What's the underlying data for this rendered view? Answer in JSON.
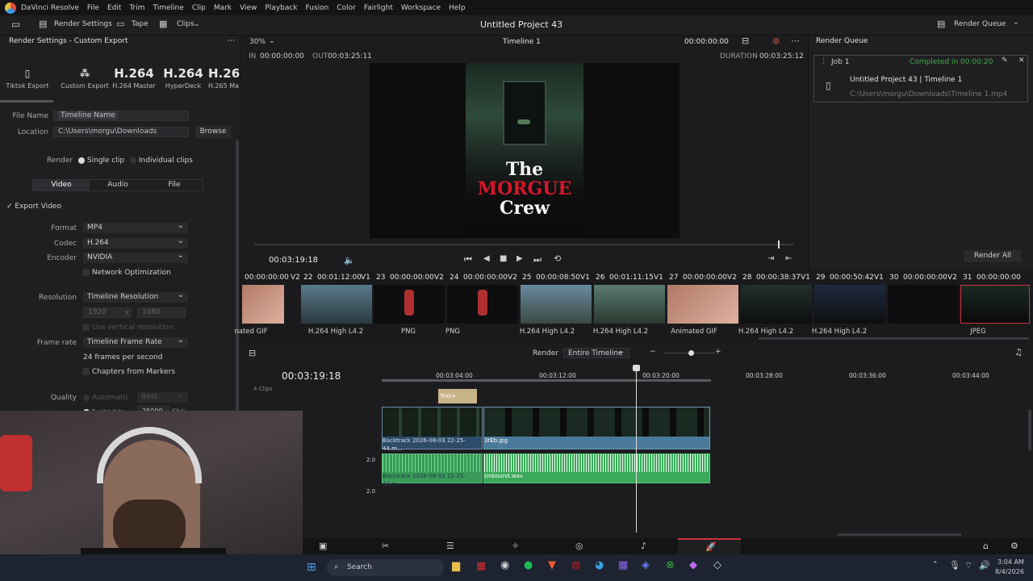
{
  "app": {
    "name": "DaVinci Resolve",
    "project_title": "Untitled Project 43"
  },
  "menu": [
    "File",
    "Edit",
    "Trim",
    "Timeline",
    "Clip",
    "Mark",
    "View",
    "Playback",
    "Fusion",
    "Color",
    "Fairlight",
    "Workspace",
    "Help"
  ],
  "toolbar": {
    "render_settings": "Render Settings",
    "tape": "Tape",
    "clips": "Clips"
  },
  "render_settings": {
    "title": "Render Settings - Custom Export",
    "presets": [
      {
        "big": "",
        "label": "Tiktok Export"
      },
      {
        "big": "",
        "label": "Custom Export"
      },
      {
        "big": "H.264",
        "label": "H.264 Master"
      },
      {
        "big": "H.264",
        "label": "HyperDeck"
      },
      {
        "big": "H.26",
        "label": "H.265 Ma"
      }
    ],
    "file_name_label": "File Name",
    "file_name_placeholder": "Timeline Name",
    "location_label": "Location",
    "location_value": "C:\\Users\\morgu\\Downloads",
    "browse": "Browse",
    "render_label": "Render",
    "single_clip": "Single clip",
    "individual_clips": "Individual clips",
    "tabs": [
      "Video",
      "Audio",
      "File"
    ],
    "export_video": "Export Video",
    "format_label": "Format",
    "format_value": "MP4",
    "codec_label": "Codec",
    "codec_value": "H.264",
    "encoder_label": "Encoder",
    "encoder_value": "NVIDIA",
    "network_opt": "Network Optimization",
    "resolution_label": "Resolution",
    "resolution_value": "Timeline Resolution",
    "res_w": "1920",
    "res_x": "x",
    "res_h": "1080",
    "vertical_res": "Use vertical resolution",
    "frame_rate_label": "Frame rate",
    "frame_rate_value": "Timeline Frame Rate",
    "fps_text": "24 frames per second",
    "chapters": "Chapters from Markers",
    "quality_label": "Quality",
    "automatic": "Automatic",
    "best": "Best",
    "restrict": "Restrict to",
    "restrict_val": "25000",
    "kbps": "Kb/s"
  },
  "viewer": {
    "zoom": "30%",
    "timeline_name": "Timeline 1",
    "tc_top": "00:00:00:00",
    "in_label": "IN",
    "in_tc": "00:00:00:00",
    "out_label": "OUT",
    "out_tc": "00:03:25:11",
    "duration_label": "DURATION",
    "duration_tc": "00:03:25:12",
    "current_tc": "00:03:19:18",
    "poster_line1": "The",
    "poster_line2": "MORGUE",
    "poster_line3": "Crew"
  },
  "render_queue": {
    "title": "Render Queue",
    "job": "Job 1",
    "status": "Completed in 00:00:20",
    "job_title": "Untitled Project 43 | Timeline 1",
    "job_path": "C:\\Users\\morgu\\Downloads\\Timeline 1.mp4",
    "render_all": "Render All"
  },
  "clips": [
    {
      "num": "",
      "tc": "",
      "track": "",
      "label": "nated GIF"
    },
    {
      "num": "22",
      "tc": "00:01:12:00",
      "track": "V1",
      "label": "H.264 High L4.2"
    },
    {
      "num": "23",
      "tc": "00:00:00:00",
      "track": "V2",
      "label": "PNG"
    },
    {
      "num": "24",
      "tc": "00:00:00:00",
      "track": "V2",
      "label": "PNG"
    },
    {
      "num": "25",
      "tc": "00:00:08:50",
      "track": "V1",
      "label": "H.264 High L4.2"
    },
    {
      "num": "26",
      "tc": "00:01:11:15",
      "track": "V1",
      "label": "H.264 High L4.2"
    },
    {
      "num": "27",
      "tc": "00:00:00:00",
      "track": "V2",
      "label": "Animated GIF"
    },
    {
      "num": "28",
      "tc": "00:00:38:37",
      "track": "V1",
      "label": "H.264 High L4.2"
    },
    {
      "num": "29",
      "tc": "00:00:50:42",
      "track": "V1",
      "label": "H.264 High L4.2"
    },
    {
      "num": "30",
      "tc": "00:00:00:00",
      "track": "V2",
      "label": ""
    },
    {
      "num": "31",
      "tc": "00:00:00:00",
      "track": "",
      "label": "JPEG"
    }
  ],
  "first_clip_tc": "00:00:00:00",
  "first_clip_track": "V2",
  "timeline": {
    "render_label": "Render",
    "render_range": "Entire Timeline",
    "tc": "00:03:19:18",
    "ruler": [
      "00:03:04:00",
      "00:03:12:00",
      "00:03:20:00",
      "00:03:28:00",
      "00:03:36:00",
      "00:03:44:00"
    ],
    "clips_label": "4 Clips",
    "text_clip": "Text+",
    "v1_clip_a": "Backtrack 2026-08-03 22-25-44.m...",
    "v1_clip_b": "3tEb.jpg",
    "a1_clip_a": "Backtrack 2026-08-03 22-25-44.m...",
    "a1_clip_b": "Unbound.wav",
    "a_level1": "2.0",
    "a_level2": "2.0"
  },
  "taskbar": {
    "search": "Search",
    "time": "3:04 AM",
    "date": "8/4/2026"
  }
}
